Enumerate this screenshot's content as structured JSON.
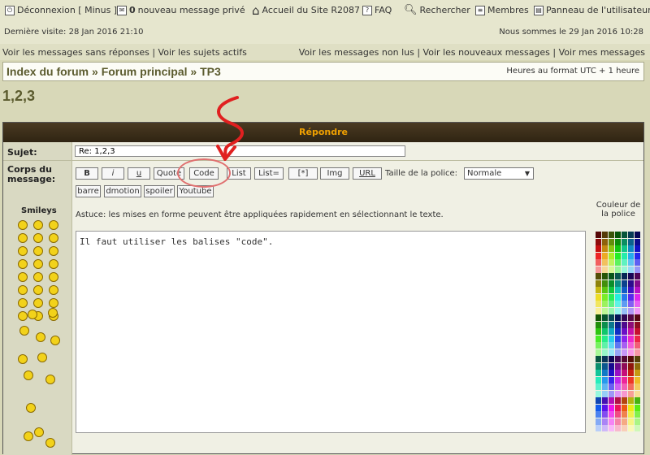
{
  "topbar": {
    "logout": "Déconnexion [ Minus ]",
    "private_count": "0",
    "private_text": "nouveau message privé",
    "home": "Accueil du Site R2087",
    "faq": "FAQ",
    "search": "Rechercher",
    "members": "Membres",
    "panel": "Panneau de l'utilisateur"
  },
  "info": {
    "last_visit": "Dernière visite: 28 Jan 2016 21:10",
    "today": "Nous sommes le 29 Jan 2016 10:28"
  },
  "links": {
    "unanswered": "Voir les messages sans réponses",
    "active": "Voir les sujets actifs",
    "unread": "Voir les messages non lus",
    "new_msgs": "Voir les nouveaux messages",
    "my_msgs": "Voir mes messages",
    "sep": "|"
  },
  "breadcrumb": {
    "index": "Index du forum",
    "forum": "Forum principal",
    "topic": "TP3",
    "sep": "»",
    "timezone": "Heures au format UTC + 1 heure"
  },
  "page_title": "1,2,3",
  "reply": {
    "header": "Répondre",
    "subject_label": "Sujet:",
    "subject_value": "Re: 1,2,3",
    "body_label": "Corps du message:",
    "smileys_label": "Smileys",
    "buttons": [
      "B",
      "i",
      "u",
      "Quote",
      "Code",
      "List",
      "List=",
      "[*]",
      "Img",
      "URL"
    ],
    "buttons2": [
      "barre",
      "dmotion",
      "spoiler",
      "Youtube"
    ],
    "font_size_label": "Taille de la police:",
    "font_size_value": "Normale",
    "tip": "Astuce: les mises en forme peuvent être appliquées rapidement en sélectionnant le texte.",
    "message": "Il faut utiliser les balises \"code\".",
    "color_label": "Couleur de la police"
  },
  "colors": {
    "accent": "#f0a000",
    "annotation": "#e02020"
  }
}
